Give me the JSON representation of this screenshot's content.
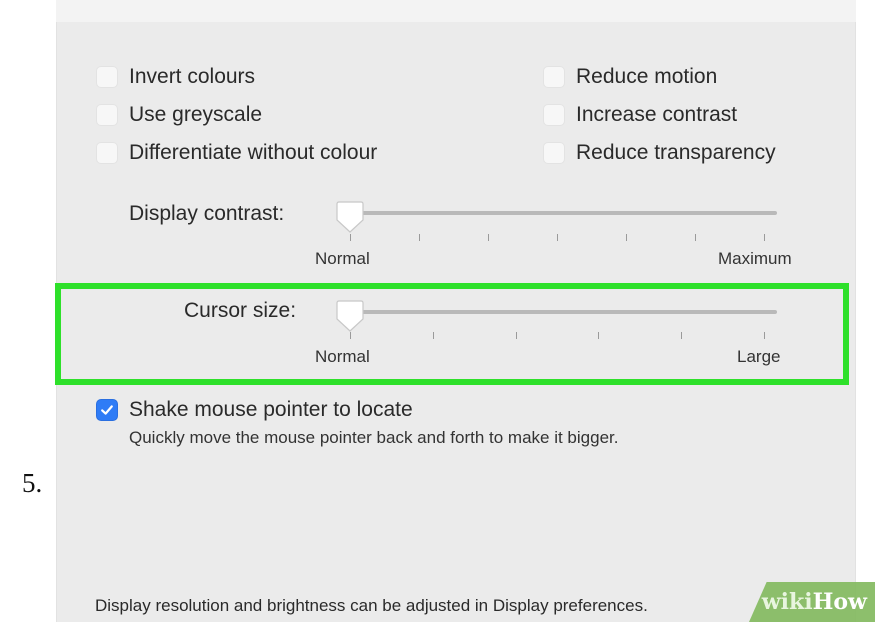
{
  "step": {
    "number": "5."
  },
  "checkboxes": {
    "left": [
      {
        "label": "Invert colours",
        "checked": false
      },
      {
        "label": "Use greyscale",
        "checked": false
      },
      {
        "label": "Differentiate without colour",
        "checked": false
      }
    ],
    "right": [
      {
        "label": "Reduce motion",
        "checked": false
      },
      {
        "label": "Increase contrast",
        "checked": false
      },
      {
        "label": "Reduce transparency",
        "checked": false
      }
    ]
  },
  "display_contrast": {
    "label": "Display contrast:",
    "min_label": "Normal",
    "max_label": "Maximum",
    "value": 0
  },
  "cursor_size": {
    "label": "Cursor size:",
    "min_label": "Normal",
    "max_label": "Large",
    "value": 0
  },
  "shake": {
    "label": "Shake mouse pointer to locate",
    "checked": true,
    "description": "Quickly move the mouse pointer back and forth to make it bigger."
  },
  "footer": {
    "text": "Display resolution and brightness can be adjusted in Display preferences."
  },
  "watermark": {
    "wiki": "wiki",
    "how": "How"
  },
  "colors": {
    "highlight": "#2ee02a",
    "checkbox_checked": "#2f7cf6",
    "panel": "#ebebeb"
  }
}
